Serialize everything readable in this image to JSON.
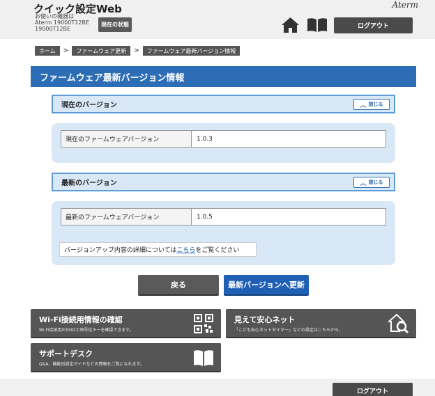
{
  "header": {
    "app_title": "クイック設定Web",
    "device_label": "お使いの機器は",
    "device_lines": [
      "Aterm 19000T12BE",
      "19000T12BE"
    ],
    "status_button": "現在の状態",
    "brand": "Aterm",
    "home_icon": "home-icon",
    "book_icon": "book-icon",
    "logout_button": "ログアウト"
  },
  "breadcrumb": [
    {
      "label": "ホーム"
    },
    {
      "label": "ファームウェア更新"
    },
    {
      "label": "ファームウェア最新バージョン情報"
    }
  ],
  "breadcrumb_separator": ">",
  "page_title": "ファームウェア最新バージョン情報",
  "sections": [
    {
      "title": "現在のバージョン",
      "close_label": "閉じる",
      "row_label": "現在のファームウェアバージョン",
      "row_value": "1.0.3"
    },
    {
      "title": "最新のバージョン",
      "close_label": "閉じる",
      "row_label": "最新のファームウェアバージョン",
      "row_value": "1.0.5",
      "note_prefix": "バージョンアップ内容の詳細については",
      "note_link": "こちら",
      "note_suffix": "をご覧ください"
    }
  ],
  "buttons": {
    "back": "戻る",
    "update": "最新バージョンへ更新"
  },
  "cards": [
    {
      "title": "Wi-Fi接続用情報の確認",
      "desc": "Wi-Fi接続用のSSIDと暗号化キーを確認できます。",
      "icon": "qr-code-icon"
    },
    {
      "title": "見えて安心ネット",
      "desc": "「こども安心ネットタイマー」などの設定はこちらから。",
      "icon": "house-search-icon"
    },
    {
      "title": "サポートデスク",
      "desc": "Q&A、機能別設定ガイドなどの情報をご覧になれます。",
      "icon": "book-icon"
    }
  ],
  "footer": {
    "logout_button": "ログアウト"
  },
  "colors": {
    "accent_blue": "#2d6db5",
    "section_bg": "#d9e8f7",
    "dark_button": "#555555"
  }
}
